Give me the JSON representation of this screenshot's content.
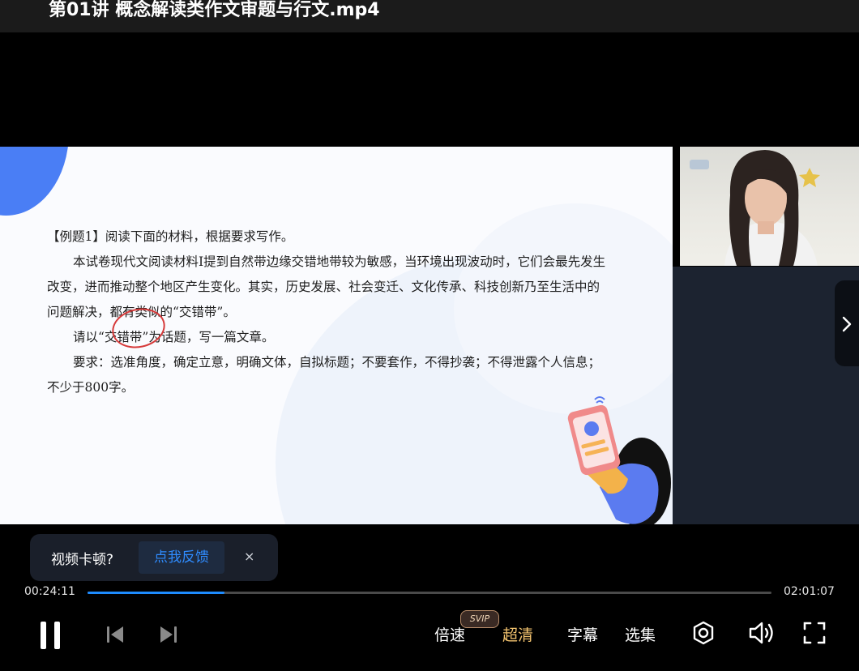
{
  "header": {
    "title": "第01讲 概念解读类作文审题与行文.mp4"
  },
  "slide": {
    "lines": [
      "【例题1】阅读下面的材料，根据要求写作。",
      "本试卷现代文阅读材料Ⅰ提到自然带边缘交错地带较为敏感，当环境出现波动时，它们会最先发生改变，进而推动整个地区产生变化。其实，历史发展、社会变迁、文化传承、科技创新乃至生活中的问题解决，都有类似的“交错带”。",
      "请以“交错带”为话题，写一篇文章。",
      "要求：选准角度，确定立意，明确文体，自拟标题；不要套作，不得抄袭；不得泄露个人信息；不少于800字。"
    ]
  },
  "feedback": {
    "question": "视频卡顿?",
    "button": "点我反馈",
    "close": "×"
  },
  "player": {
    "current_time": "00:24:11",
    "total_time": "02:01:07",
    "progress_fraction": 0.2,
    "accent_color": "#1e8cff",
    "speed_label": "倍速",
    "svip_badge": "SVIP",
    "quality_label": "超清",
    "quality_color": "#f4c46f",
    "subtitle_label": "字幕",
    "episodes_label": "选集"
  },
  "icons": [
    "pause-icon",
    "previous-icon",
    "next-icon",
    "danmaku-icon",
    "volume-icon",
    "fullscreen-icon",
    "chevron-right-icon"
  ]
}
